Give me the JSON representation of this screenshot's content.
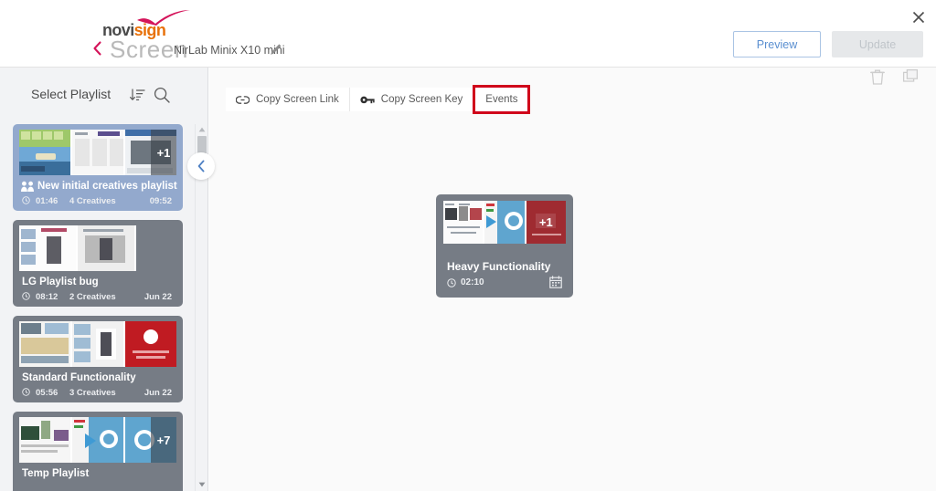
{
  "header": {
    "logo_novi": "novi",
    "logo_sign": "sign",
    "screen_label": "Screen",
    "screen_name": "NirLab Minix X10 mini",
    "preview_label": "Preview",
    "update_label": "Update",
    "close_icon": "close-icon",
    "back_icon": "back-chevron-icon",
    "edit_icon": "pencil-icon"
  },
  "sidebar": {
    "title": "Select Playlist",
    "sort_icon": "sort-descending-icon",
    "search_icon": "search-icon",
    "collapse_icon": "chevron-left-icon",
    "playlists": [
      {
        "name": "New initial creatives playlist",
        "duration": "01:46",
        "creatives": "4 Creatives",
        "right": "09:52",
        "selected": true,
        "has_group_icon": true,
        "overlay": "+1",
        "thumbs": 3
      },
      {
        "name": "LG Playlist bug",
        "duration": "08:12",
        "creatives": "2 Creatives",
        "right": "Jun 22",
        "selected": false,
        "has_group_icon": false,
        "overlay": "",
        "thumbs": 2
      },
      {
        "name": "Standard Functionality",
        "duration": "05:56",
        "creatives": "3 Creatives",
        "right": "Jun 22",
        "selected": false,
        "has_group_icon": false,
        "overlay": "",
        "thumbs": 3
      },
      {
        "name": "Temp Playlist",
        "duration": "",
        "creatives": "",
        "right": "",
        "selected": false,
        "has_group_icon": false,
        "overlay": "+7",
        "thumbs": 3
      }
    ]
  },
  "toolbar": {
    "copy_screen_link": "Copy Screen Link",
    "copy_screen_key": "Copy Screen Key",
    "events": "Events",
    "link_icon": "link-icon",
    "key_icon": "key-icon",
    "highlight_color": "#d0021b"
  },
  "content": {
    "delete_icon": "trash-icon",
    "duplicate_icon": "copy-icon",
    "creative": {
      "name": "Heavy Functionality",
      "duration": "02:10",
      "calendar_icon": "calendar-icon",
      "overlay": "+1"
    }
  },
  "colors": {
    "accent_blue": "#5a8fd0",
    "selected_playlist": "#93a9cd",
    "card_gray": "#767c85",
    "brand_orange": "#e8710a",
    "brand_pink": "#d4145a"
  }
}
